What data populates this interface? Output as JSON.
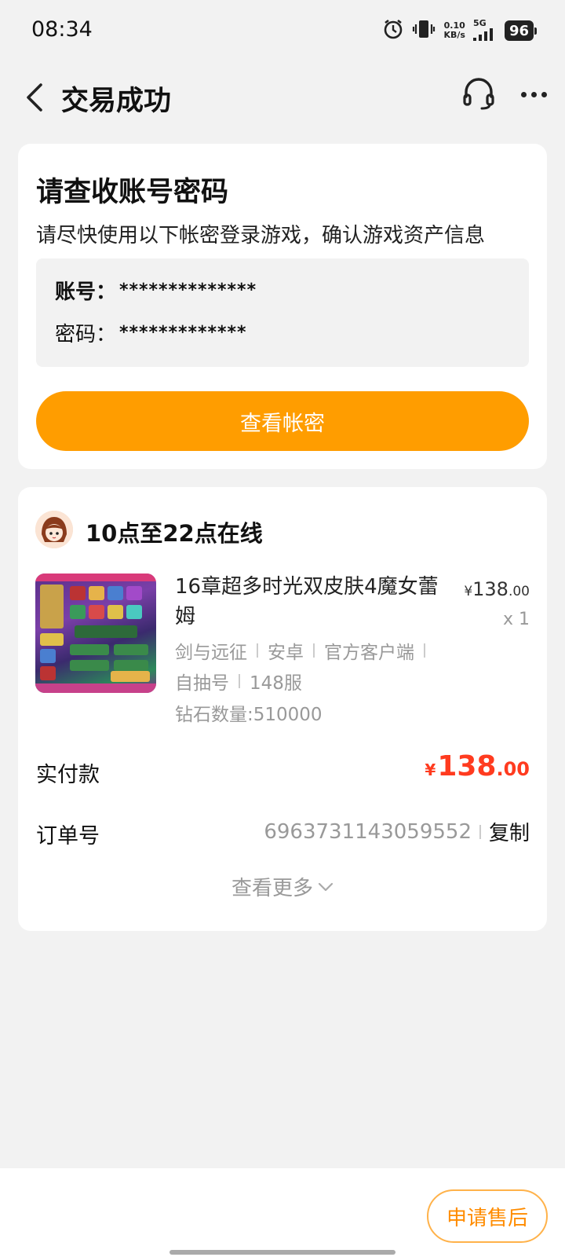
{
  "status_bar": {
    "time": "08:34",
    "net_speed_value": "0.10",
    "net_speed_unit": "KB/s",
    "network": "5G",
    "battery": "96",
    "icons": [
      "alarm-icon",
      "vibrate-icon",
      "signal-icon",
      "battery-icon"
    ]
  },
  "header": {
    "title": "交易成功",
    "icons": [
      "back-icon",
      "headset-icon",
      "more-icon"
    ]
  },
  "account_card": {
    "title": "请查收账号密码",
    "subtitle": "请尽快使用以下帐密登录游戏，确认游戏资产信息",
    "account_label": "账号：",
    "account_value": "**************",
    "password_label": "密码：",
    "password_value": "*************",
    "view_button": "查看帐密"
  },
  "order_card": {
    "seller_status": "10点至22点在线",
    "product": {
      "title": "16章超多时光双皮肤4魔女蕾姆",
      "price_yen": "¥",
      "price_int": "138",
      "price_dec": ".00",
      "quantity": "x 1",
      "tags_line1": [
        "剑与远征",
        "安卓",
        "官方客户端"
      ],
      "tags_line2": [
        "自抽号",
        "148服"
      ],
      "diamonds": "钻石数量:510000"
    },
    "pay_label": "实付款",
    "pay_yen": "¥",
    "pay_int": "138",
    "pay_dec": ".00",
    "order_label": "订单号",
    "order_number": "6963731143059552",
    "copy_label": "复制",
    "see_more": "查看更多"
  },
  "bottom": {
    "after_sales_button": "申请售后"
  },
  "colors": {
    "accent": "#ff9d00",
    "price_red": "#ff3b1f",
    "background": "#f2f2f2"
  }
}
